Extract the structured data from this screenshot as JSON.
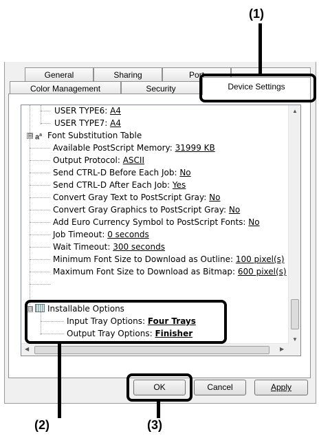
{
  "callouts": {
    "c1": "(1)",
    "c2": "(2)",
    "c3": "(3)"
  },
  "tabs": {
    "row1": [
      "General",
      "Sharing",
      "Port"
    ],
    "row2": [
      "Color Management",
      "Security",
      "Device Settings"
    ]
  },
  "tree": {
    "items": [
      {
        "label": "USER TYPE6: ",
        "value": "A4"
      },
      {
        "label": "USER TYPE7: ",
        "value": "A4"
      },
      {
        "label": "Font Substitution Table",
        "value": ""
      },
      {
        "label": "Available PostScript Memory: ",
        "value": "31999 KB"
      },
      {
        "label": "Output Protocol: ",
        "value": "ASCII"
      },
      {
        "label": "Send CTRL-D Before Each Job: ",
        "value": "No"
      },
      {
        "label": "Send CTRL-D After Each Job: ",
        "value": "Yes"
      },
      {
        "label": "Convert Gray Text to PostScript Gray: ",
        "value": "No"
      },
      {
        "label": "Convert Gray Graphics to PostScript Gray: ",
        "value": "No"
      },
      {
        "label": "Add Euro Currency Symbol to PostScript Fonts: ",
        "value": "No"
      },
      {
        "label": "Job Timeout: ",
        "value": "0 seconds"
      },
      {
        "label": "Wait Timeout: ",
        "value": "300 seconds"
      },
      {
        "label": "Minimum Font Size to Download as Outline: ",
        "value": "100 pixel(s)"
      },
      {
        "label": "Maximum Font Size to Download as Bitmap: ",
        "value": "600 pixel(s)"
      },
      {
        "label": "Installable Options",
        "value": ""
      },
      {
        "label": "Input Tray Options: ",
        "value": "Four Trays"
      },
      {
        "label": "Output Tray Options: ",
        "value": "Finisher"
      }
    ],
    "expander_symbol": "⊞",
    "collapse_symbol": "⊟"
  },
  "buttons": {
    "ok": "OK",
    "cancel": "Cancel",
    "apply": "Apply"
  },
  "colors": {
    "highlight": "#000000",
    "tab_border": "#8e8f8f"
  }
}
